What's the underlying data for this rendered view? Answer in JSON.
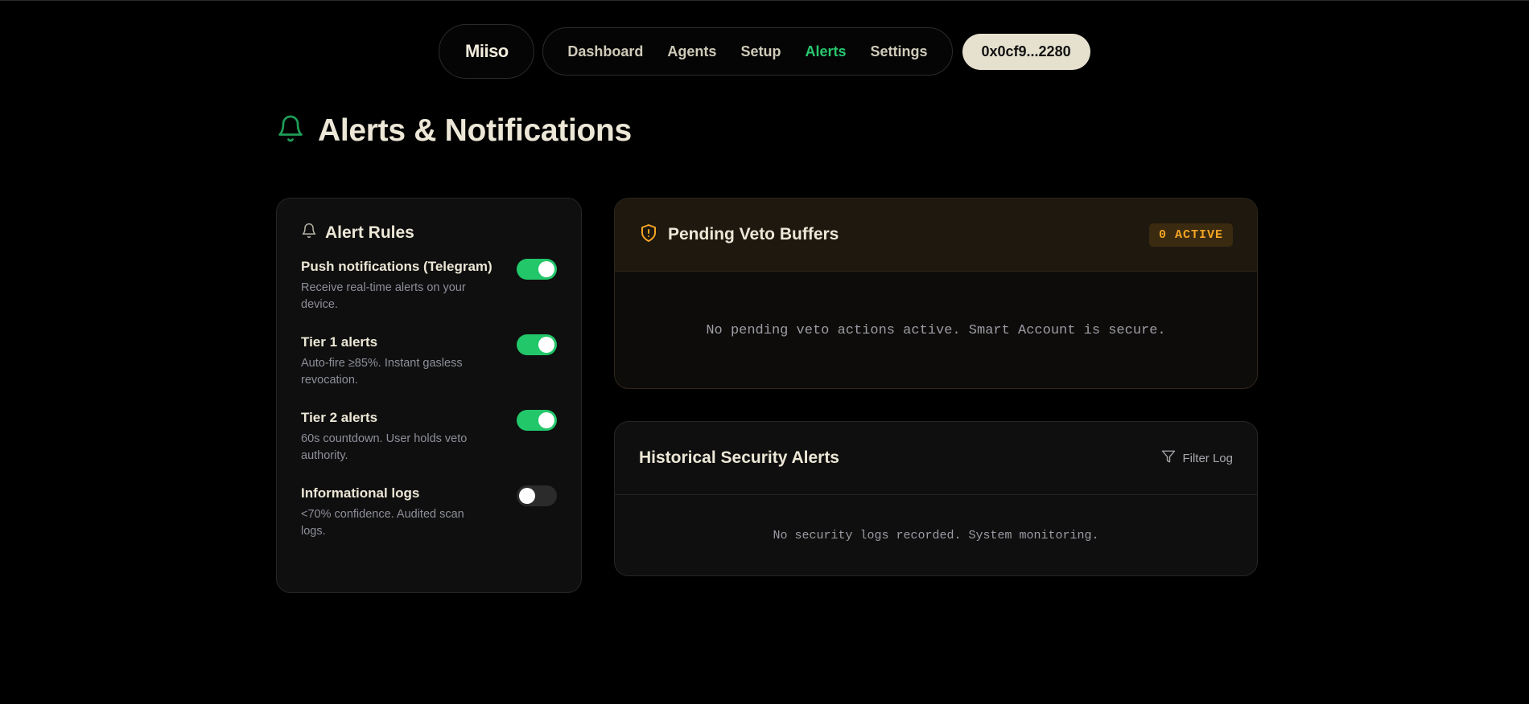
{
  "nav": {
    "brand": "Miiso",
    "links": [
      {
        "label": "Dashboard",
        "active": false
      },
      {
        "label": "Agents",
        "active": false
      },
      {
        "label": "Setup",
        "active": false
      },
      {
        "label": "Alerts",
        "active": true
      },
      {
        "label": "Settings",
        "active": false
      }
    ],
    "wallet": "0x0cf9...2280"
  },
  "page": {
    "title": "Alerts & Notifications",
    "icon": "bell-icon",
    "accent": "#28c76f"
  },
  "alert_rules": {
    "title": "Alert Rules",
    "icon": "bell-icon",
    "rules": [
      {
        "name": "Push notifications (Telegram)",
        "desc": "Receive real-time alerts on your device.",
        "enabled": true
      },
      {
        "name": "Tier 1 alerts",
        "desc": "Auto-fire ≥85%. Instant gasless revocation.",
        "enabled": true
      },
      {
        "name": "Tier 2 alerts",
        "desc": "60s countdown. User holds veto authority.",
        "enabled": true
      },
      {
        "name": "Informational logs",
        "desc": "<70% confidence. Audited scan logs.",
        "enabled": false
      }
    ]
  },
  "veto": {
    "title": "Pending Veto Buffers",
    "icon": "shield-alert-icon",
    "badge": "0 ACTIVE",
    "badge_color": "#f5a524",
    "empty_message": "No pending veto actions active. Smart Account is secure."
  },
  "history": {
    "title": "Historical Security Alerts",
    "filter_label": "Filter Log",
    "filter_icon": "filter-icon",
    "empty_message": "No security logs recorded. System monitoring."
  }
}
